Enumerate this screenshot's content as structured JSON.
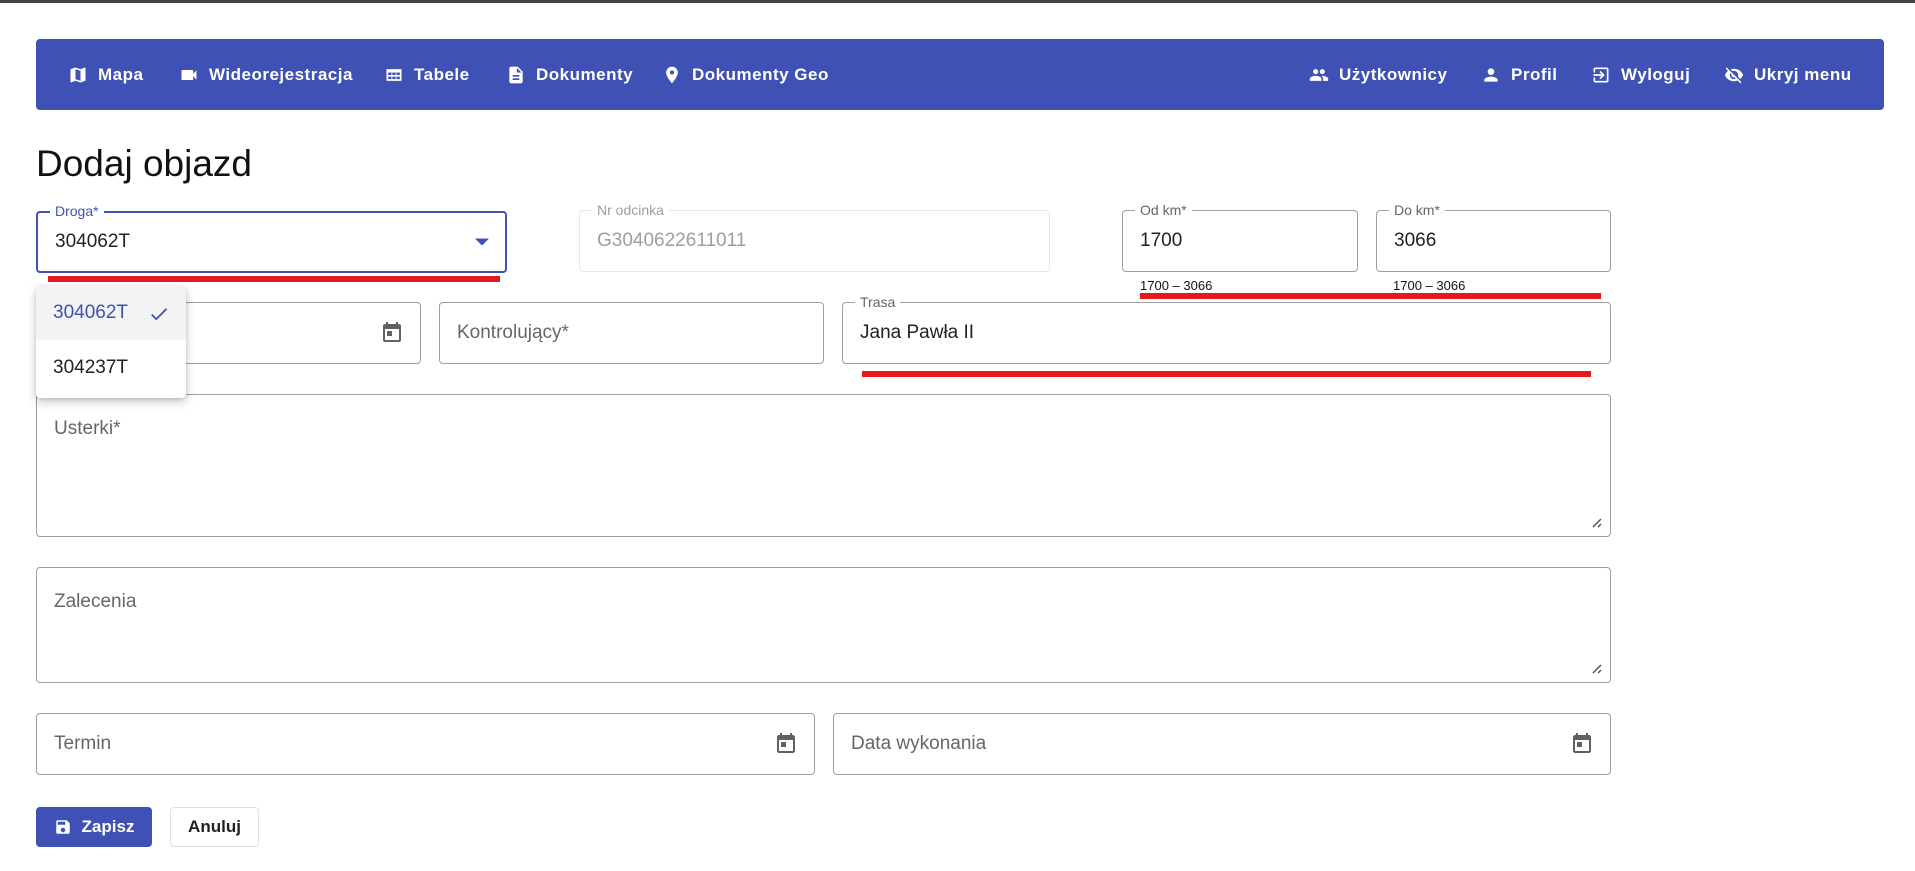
{
  "nav": {
    "left": [
      {
        "label": "Mapa",
        "icon": "map-icon"
      },
      {
        "label": "Wideorejestracja",
        "icon": "videocam-icon"
      },
      {
        "label": "Tabele",
        "icon": "table-icon"
      },
      {
        "label": "Dokumenty",
        "icon": "document-icon"
      },
      {
        "label": "Dokumenty Geo",
        "icon": "location-pin-icon"
      }
    ],
    "right": [
      {
        "label": "Użytkownicy",
        "icon": "users-icon"
      },
      {
        "label": "Profil",
        "icon": "person-icon"
      },
      {
        "label": "Wyloguj",
        "icon": "logout-icon"
      },
      {
        "label": "Ukryj menu",
        "icon": "eye-off-icon"
      }
    ]
  },
  "page": {
    "title": "Dodaj objazd"
  },
  "form": {
    "droga": {
      "label": "Droga*",
      "value": "304062T",
      "options": [
        "304062T",
        "304237T"
      ],
      "selected": "304062T"
    },
    "nr_odcinka": {
      "label": "Nr odcinka",
      "value": "G3040622611011"
    },
    "od_km": {
      "label": "Od km*",
      "value": "1700",
      "hint": "1700 – 3066"
    },
    "do_km": {
      "label": "Do km*",
      "value": "3066",
      "hint": "1700 – 3066"
    },
    "kontrolujacy": {
      "placeholder": "Kontrolujący*"
    },
    "trasa": {
      "label": "Trasa",
      "value": "Jana Pawła II"
    },
    "usterki": {
      "placeholder": "Usterki*"
    },
    "zalecenia": {
      "placeholder": "Zalecenia"
    },
    "termin": {
      "placeholder": "Termin"
    },
    "data_wykonania": {
      "placeholder": "Data wykonania"
    }
  },
  "actions": {
    "save_label": "Zapisz",
    "cancel_label": "Anuluj"
  },
  "colors": {
    "primary": "#3f51b5",
    "highlight": "#e11b1b"
  }
}
